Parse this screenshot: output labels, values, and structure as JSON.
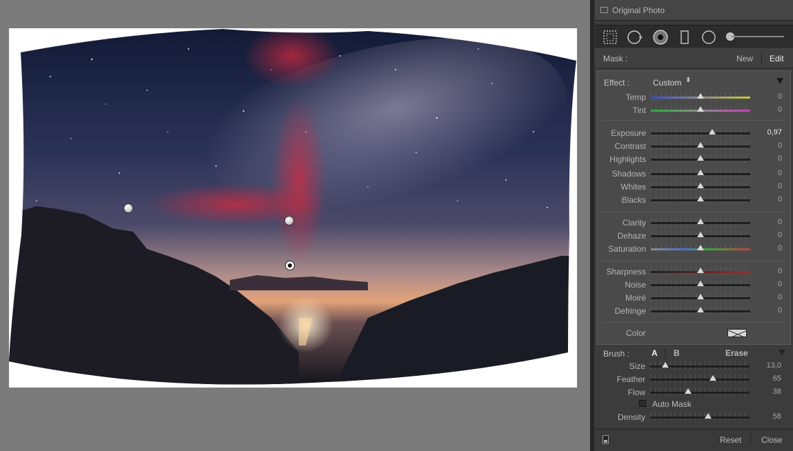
{
  "window": {
    "original_photo_label": "Original Photo"
  },
  "tools": [
    {
      "name": "graduated-filter-icon"
    },
    {
      "name": "spot-removal-icon"
    },
    {
      "name": "red-eye-icon"
    },
    {
      "name": "graduated-filter-rect-icon"
    },
    {
      "name": "radial-filter-icon"
    },
    {
      "name": "adjustment-brush-icon"
    }
  ],
  "mask": {
    "label": "Mask :",
    "new_label": "New",
    "edit_label": "Edit"
  },
  "effect": {
    "label": "Effect :",
    "value": "Custom",
    "arrows": "◆"
  },
  "sliders": [
    {
      "key": "temp",
      "label": "Temp",
      "value": "0",
      "position": 0.5,
      "track": "temp"
    },
    {
      "key": "tint",
      "label": "Tint",
      "value": "0",
      "position": 0.5,
      "track": "tint"
    },
    {
      "key": "exposure",
      "label": "Exposure",
      "value": "0,97",
      "position": 0.62,
      "track": "plain",
      "highlight": true
    },
    {
      "key": "contrast",
      "label": "Contrast",
      "value": "0",
      "position": 0.5,
      "track": "plain"
    },
    {
      "key": "highlights",
      "label": "Highlights",
      "value": "0",
      "position": 0.5,
      "track": "plain"
    },
    {
      "key": "shadows",
      "label": "Shadows",
      "value": "0",
      "position": 0.5,
      "track": "plain"
    },
    {
      "key": "whites",
      "label": "Whites",
      "value": "0",
      "position": 0.5,
      "track": "plain"
    },
    {
      "key": "blacks",
      "label": "Blacks",
      "value": "0",
      "position": 0.5,
      "track": "plain"
    },
    {
      "key": "clarity",
      "label": "Clarity",
      "value": "0",
      "position": 0.5,
      "track": "plain"
    },
    {
      "key": "dehaze",
      "label": "Dehaze",
      "value": "0",
      "position": 0.5,
      "track": "plain"
    },
    {
      "key": "saturation",
      "label": "Saturation",
      "value": "0",
      "position": 0.5,
      "track": "saturation"
    },
    {
      "key": "sharpness",
      "label": "Sharpness",
      "value": "0",
      "position": 0.5,
      "track": "sharpness"
    },
    {
      "key": "noise",
      "label": "Noise",
      "value": "0",
      "position": 0.5,
      "track": "plain"
    },
    {
      "key": "moire",
      "label": "Moiré",
      "value": "0",
      "position": 0.5,
      "track": "plain"
    },
    {
      "key": "defringe",
      "label": "Defringe",
      "value": "0",
      "position": 0.5,
      "track": "plain"
    }
  ],
  "color": {
    "label": "Color"
  },
  "brush": {
    "label": "Brush :",
    "a_label": "A",
    "b_label": "B",
    "erase_label": "Erase",
    "size": {
      "label": "Size",
      "value": "13,0",
      "position": 0.15
    },
    "feather": {
      "label": "Feather",
      "value": "65",
      "position": 0.63
    },
    "flow": {
      "label": "Flow",
      "value": "38",
      "position": 0.38
    },
    "auto_mask_label": "Auto Mask",
    "auto_mask_checked": false,
    "density": {
      "label": "Density",
      "value": "58",
      "position": 0.58
    }
  },
  "footer": {
    "reset_label": "Reset",
    "close_label": "Close"
  },
  "colors": {
    "panel_bg": "#3a3a3a",
    "effects_bg": "#4a4a4a",
    "canvas_bg": "#7b7b7b",
    "mask_overlay": "#c0283a"
  }
}
